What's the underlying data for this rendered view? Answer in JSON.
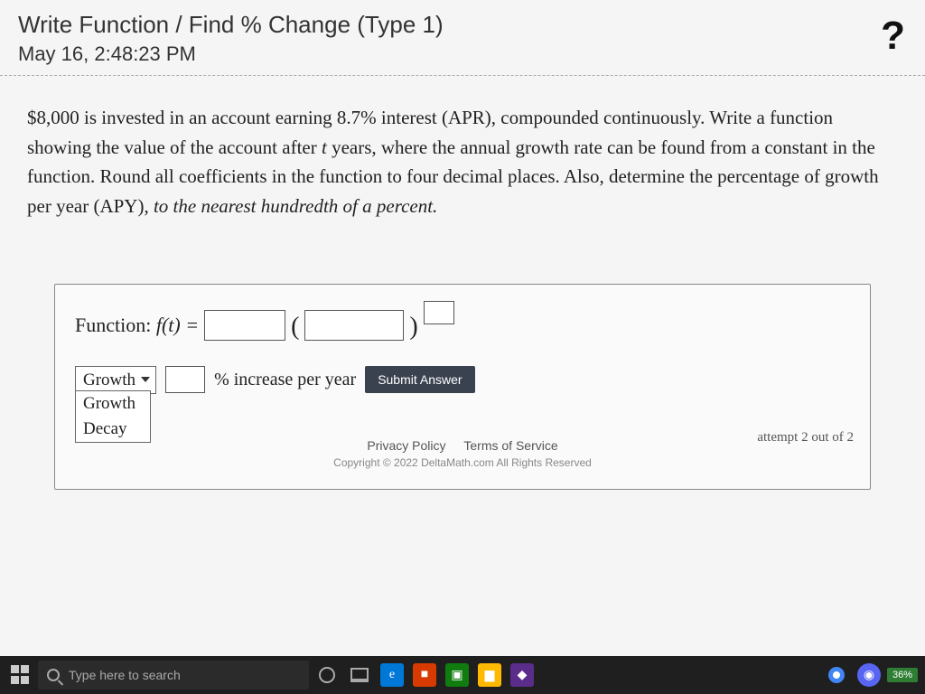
{
  "header": {
    "title": "Write Function / Find % Change (Type 1)",
    "timestamp": "May 16, 2:48:23 PM",
    "help": "?"
  },
  "problem": {
    "amount": "$8,000",
    "text1": " is invested in an account earning 8.7% interest (APR), compounded continuously. Write a function showing the value of the account after ",
    "var": "t",
    "text2": " years, where the annual growth rate can be found from a constant in the function. Round all coefficients in the function to four decimal places. Also, determine the percentage of growth per year (APY), ",
    "italic": "to the nearest hundredth of a percent."
  },
  "work": {
    "function_label": "Function: ",
    "function_expr": "f(t) =",
    "lparen": "(",
    "rparen": ")",
    "dropdown_selected": "Growth",
    "dropdown_options": [
      "Growth",
      "Decay"
    ],
    "pct_label": "% increase per year",
    "submit": "Submit Answer",
    "attempt": "attempt 2 out of 2"
  },
  "footer": {
    "privacy": "Privacy Policy",
    "terms": "Terms of Service",
    "copyright": "Copyright © 2022 DeltaMath.com All Rights Reserved"
  },
  "taskbar": {
    "search_placeholder": "Type here to search",
    "battery": "36%"
  }
}
